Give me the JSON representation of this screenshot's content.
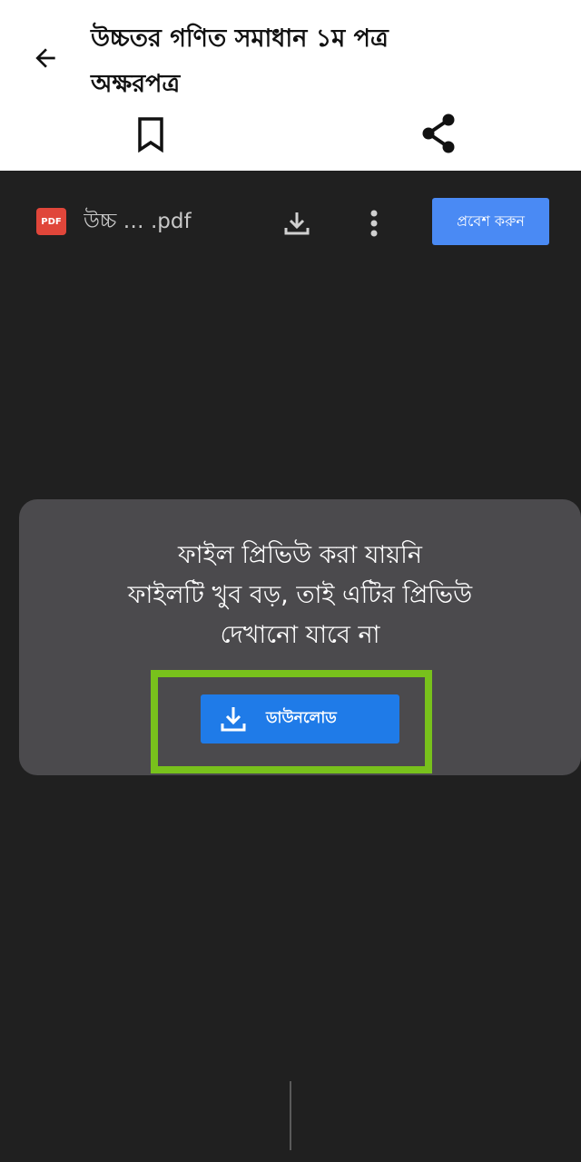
{
  "header": {
    "title_line1": "উচ্চতর গণিত সমাধান ১ম পত্র",
    "title_line2": "অক্ষরপত্র",
    "back_icon": "arrow-left-icon",
    "bookmark_icon": "bookmark-icon",
    "share_icon": "share-icon"
  },
  "viewer": {
    "file_badge": "PDF",
    "file_name": "উচ্চ … .pdf",
    "download_icon": "download-icon",
    "more_icon": "more-vertical-icon",
    "signin_label": "প্রবেশ করুন",
    "colors": {
      "signin_bg": "#4a8af4",
      "badge_bg": "#e0463a"
    }
  },
  "preview_error": {
    "line1": "ফাইল প্রিভিউ করা যায়নি",
    "line2": "ফাইলটি খুব বড়, তাই এটির প্রিভিউ",
    "line3": "দেখানো যাবে না",
    "download_label": "ডাউনলোড",
    "colors": {
      "button_bg": "#1f7be8",
      "highlight_border": "#78c11c",
      "card_bg": "#4b4a4d"
    }
  }
}
